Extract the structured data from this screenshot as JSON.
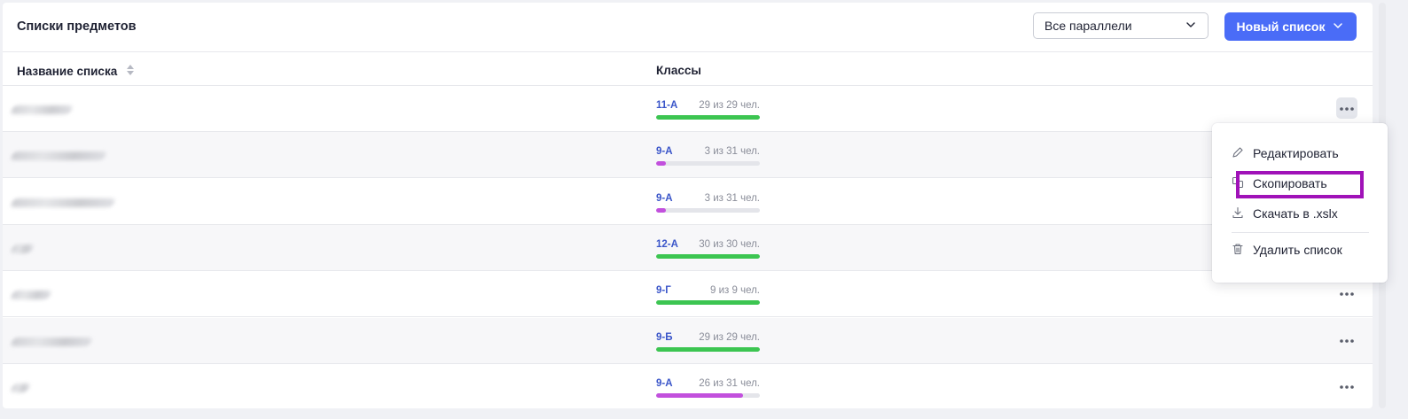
{
  "header": {
    "title": "Списки предметов",
    "parallel_select": {
      "value": "Все параллели"
    },
    "new_list_button": "Новый список"
  },
  "table": {
    "columns": {
      "name": "Название списка",
      "classes": "Классы"
    },
    "rows": [
      {
        "class": "11-А",
        "count": "29 из 29 чел.",
        "progress": 1.0,
        "color": "#3cc551"
      },
      {
        "class": "9-А",
        "count": "3 из 31 чел.",
        "progress": 0.097,
        "color": "#c250dd"
      },
      {
        "class": "9-А",
        "count": "3 из 31 чел.",
        "progress": 0.097,
        "color": "#c250dd"
      },
      {
        "class": "12-А",
        "count": "30 из 30 чел.",
        "progress": 1.0,
        "color": "#3cc551"
      },
      {
        "class": "9-Г",
        "count": "9 из 9 чел.",
        "progress": 1.0,
        "color": "#3cc551"
      },
      {
        "class": "9-Б",
        "count": "29 из 29 чел.",
        "progress": 1.0,
        "color": "#3cc551"
      },
      {
        "class": "9-А",
        "count": "26 из 31 чел.",
        "progress": 0.839,
        "color": "#c250dd"
      }
    ]
  },
  "context_menu": {
    "edit": "Редактировать",
    "copy": "Скопировать",
    "download": "Скачать в .xslx",
    "delete": "Удалить список"
  },
  "colors": {
    "accent": "#4a6cf7",
    "complete": "#3cc551",
    "partial": "#c250dd",
    "highlight": "#a012b8"
  }
}
